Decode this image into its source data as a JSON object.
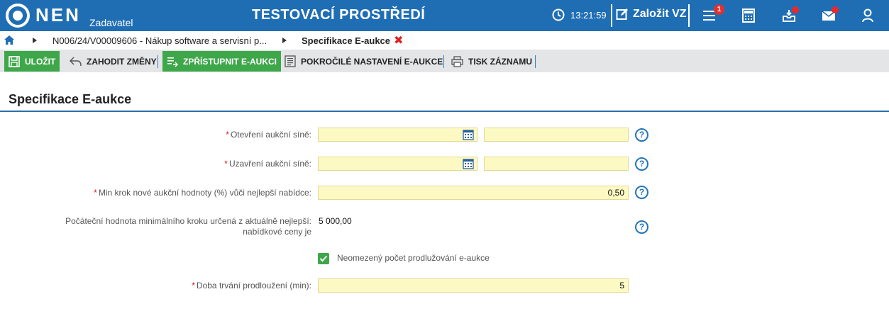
{
  "header": {
    "logo_text": "NEN",
    "logo_sub": "Zadavatel",
    "environment_title": "TESTOVACÍ PROSTŘEDÍ",
    "time": "13:21:59",
    "create_label": "Založit VZ",
    "menu_badge": "1",
    "icons": [
      "clock-icon",
      "edit-icon",
      "menu-icon",
      "calculator-icon",
      "inbox-icon",
      "mail-icon",
      "user-icon"
    ],
    "brand_color": "#1f6eb4"
  },
  "breadcrumb": {
    "items": [
      "N006/24/V00009606 - Nákup software a servisní p...",
      "Specifikace E-aukce"
    ]
  },
  "toolbar": {
    "save_label": "ULOŽIT",
    "discard_label": "ZAHODIT ZMĚNY",
    "publish_label": "ZPŘÍSTUPNIT E-AUKCI",
    "advanced_label": "POKROČILÉ NASTAVENÍ E-AUKCE",
    "print_label": "TISK ZÁZNAMU",
    "accent_green": "#3ea74a"
  },
  "section": {
    "title": "Specifikace E-aukce"
  },
  "form": {
    "opening": {
      "label": "Otevření aukční síně:",
      "date": "",
      "time": ""
    },
    "closing": {
      "label": "Uzavření aukční síně:",
      "date": "",
      "time": ""
    },
    "min_step": {
      "label": "Min krok nové aukční hodnoty (%) vůči nejlepší nabídce:",
      "value": "0,50"
    },
    "initial_value": {
      "label_line1": "Počáteční hodnota minimálního kroku určená z aktuálně nejlepší:",
      "label_line2": "nabídkové ceny je",
      "value": "5 000,00"
    },
    "unlimited_ext": {
      "label": "Neomezený počet prodlužování e-aukce",
      "checked": true
    },
    "ext_duration": {
      "label": "Doba trvání prodloužení (min):",
      "value": "5"
    },
    "help_symbol": "?"
  }
}
